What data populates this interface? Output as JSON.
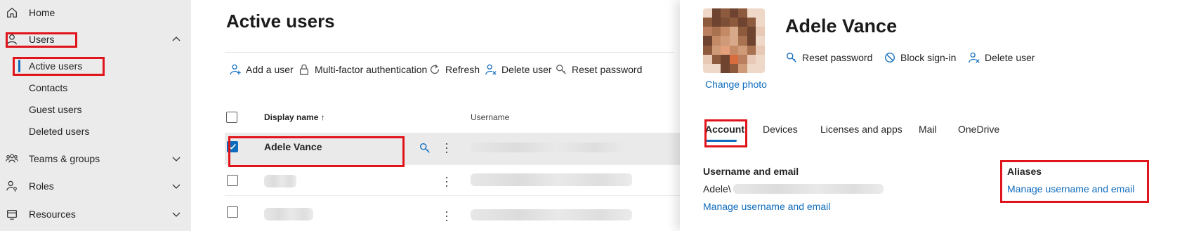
{
  "sidebar": {
    "home": "Home",
    "users": "Users",
    "sub_items": [
      "Active users",
      "Contacts",
      "Guest users",
      "Deleted users"
    ],
    "teams": "Teams & groups",
    "roles": "Roles",
    "resources": "Resources"
  },
  "main": {
    "title": "Active users",
    "toolbar": {
      "add_user": "Add a user",
      "mfa": "Multi-factor authentication",
      "refresh": "Refresh",
      "delete_user": "Delete user",
      "reset_password": "Reset password"
    },
    "columns": {
      "display_name": "Display name",
      "sort_indicator": "↑",
      "username": "Username"
    },
    "rows": [
      {
        "display_name": "Adele Vance",
        "selected": true
      },
      {
        "display_name": "",
        "selected": false
      },
      {
        "display_name": "",
        "selected": false
      }
    ]
  },
  "panel": {
    "user_name": "Adele Vance",
    "change_photo": "Change photo",
    "actions": {
      "reset_password": "Reset password",
      "block_signin": "Block sign-in",
      "delete_user": "Delete user"
    },
    "tabs": [
      "Account",
      "Devices",
      "Licenses and apps",
      "Mail",
      "OneDrive"
    ],
    "active_tab": "Account",
    "username_section": {
      "title": "Username and email",
      "value_prefix": "Adele\\",
      "manage_link": "Manage username and email"
    },
    "aliases_section": {
      "title": "Aliases",
      "manage_link": "Manage username and email"
    }
  },
  "colors": {
    "accent": "#0f6cbd",
    "highlight": "#e0141a",
    "sidebar_bg": "#ebebeb"
  }
}
